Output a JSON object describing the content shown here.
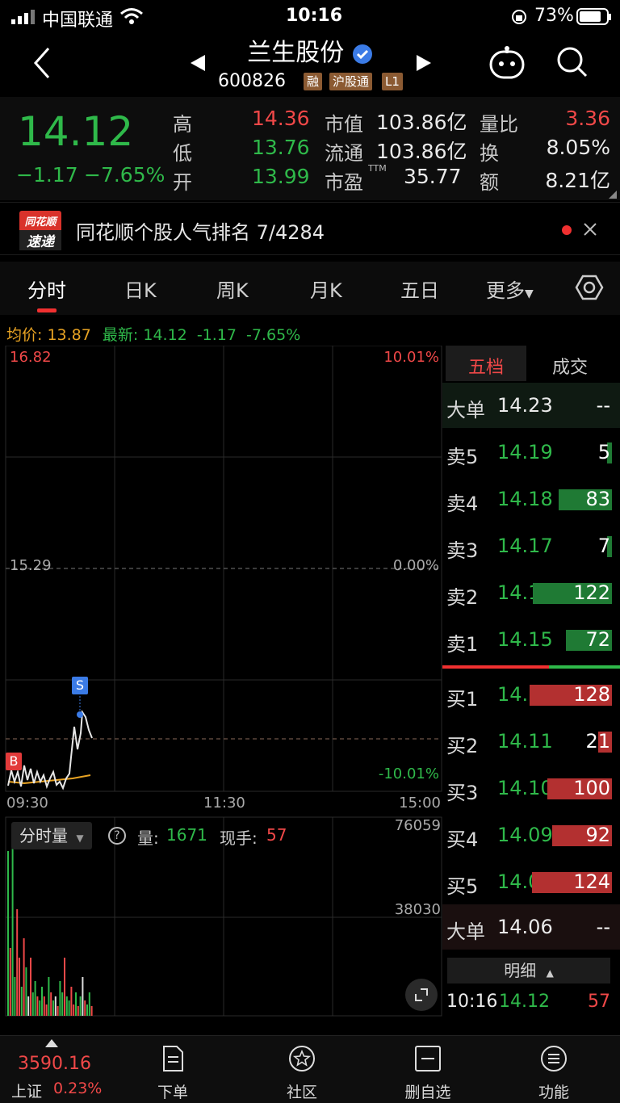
{
  "status_bar": {
    "carrier": "中国联通",
    "time": "10:16",
    "battery": "73%"
  },
  "header": {
    "name": "兰生股份",
    "code": "600826",
    "tags": [
      "融",
      "沪股通",
      "L1"
    ]
  },
  "quote": {
    "price": "14.12",
    "change": "−1.17",
    "change_pct": "−7.65%",
    "high_label": "高",
    "high": "14.36",
    "low_label": "低",
    "low": "13.76",
    "open_label": "开",
    "open": "13.99",
    "mktcap_label": "市值",
    "mktcap": "103.86亿",
    "float_label": "流通",
    "float": "103.86亿",
    "pe_label": "市盈",
    "pe_sup": "TTM",
    "pe": "35.77",
    "volratio_label": "量比",
    "volratio": "3.36",
    "turnover_label": "换",
    "turnover": "8.05%",
    "amount_label": "额",
    "amount": "8.21亿"
  },
  "banner": {
    "logo_top": "同花顺",
    "logo_bottom": "速递",
    "text": "同花顺个股人气排名 7/4284"
  },
  "tabs": [
    "分时",
    "日K",
    "周K",
    "月K",
    "五日",
    "更多"
  ],
  "chart_info": {
    "avg_label": "均价:",
    "avg": "13.87",
    "latest_label": "最新:",
    "latest": "14.12",
    "chg": "-1.17",
    "pct": "-7.65%"
  },
  "price_axis": {
    "top": "16.82",
    "mid": "15.29",
    "top_pct": "10.01%",
    "mid_pct": "0.00%",
    "bot_pct": "-10.01%"
  },
  "time_axis": [
    "09:30",
    "11:30",
    "15:00"
  ],
  "markers": {
    "sell": "S",
    "buy": "B"
  },
  "volume_panel": {
    "dropdown": "分时量",
    "help": "?",
    "vol_label": "量:",
    "vol": "1671",
    "hand_label": "现手:",
    "hand": "57",
    "max": "76059",
    "mid": "38030"
  },
  "orderbook": {
    "tab_active": "五档",
    "tab_other": "成交",
    "big_sell": {
      "label": "大单",
      "price": "14.23",
      "vol": "--"
    },
    "asks": [
      {
        "label": "卖5",
        "price": "14.19",
        "vol": "5",
        "ratio": 0.04
      },
      {
        "label": "卖4",
        "price": "14.18",
        "vol": "83",
        "ratio": 0.6
      },
      {
        "label": "卖3",
        "price": "14.17",
        "vol": "7",
        "ratio": 0.05
      },
      {
        "label": "卖2",
        "price": "14.16",
        "vol": "122",
        "ratio": 0.89
      },
      {
        "label": "卖1",
        "price": "14.15",
        "vol": "72",
        "ratio": 0.52
      }
    ],
    "bids": [
      {
        "label": "买1",
        "price": "14.12",
        "vol": "128",
        "ratio": 0.93
      },
      {
        "label": "买2",
        "price": "14.11",
        "vol": "21",
        "ratio": 0.15
      },
      {
        "label": "买3",
        "price": "14.10",
        "vol": "100",
        "ratio": 0.73
      },
      {
        "label": "买4",
        "price": "14.09",
        "vol": "92",
        "ratio": 0.67
      },
      {
        "label": "买5",
        "price": "14.08",
        "vol": "124",
        "ratio": 0.9
      }
    ],
    "big_buy": {
      "label": "大单",
      "price": "14.06",
      "vol": "--"
    },
    "detail_label": "明细",
    "detail_row": {
      "time": "10:16",
      "price": "14.12",
      "vol": "57"
    }
  },
  "bottom_nav": {
    "index_value": "3590.16",
    "index_name": "上证",
    "index_pct": "0.23%",
    "items": [
      "下单",
      "社区",
      "删自选",
      "功能"
    ]
  },
  "colors": {
    "up": "#f04848",
    "down": "#2fb94a",
    "avg": "#e8a323"
  }
}
